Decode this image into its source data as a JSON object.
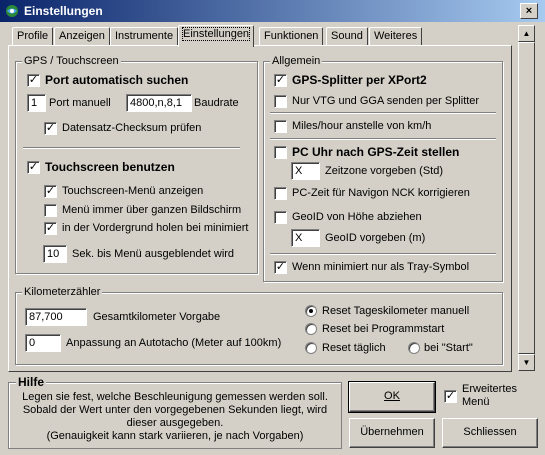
{
  "window": {
    "title": "Einstellungen",
    "close_label": "×"
  },
  "tabs": [
    {
      "label": "Profile"
    },
    {
      "label": "Anzeigen"
    },
    {
      "label": "Instrumente"
    },
    {
      "label": "Einstellungen"
    },
    {
      "label": "Funktionen"
    },
    {
      "label": "Sound"
    },
    {
      "label": "Weiteres"
    }
  ],
  "active_tab": "Einstellungen",
  "gps": {
    "legend": "GPS / Touchscreen",
    "port_auto_label": "Port automatisch suchen",
    "port_auto_checked": true,
    "port_value": "1",
    "port_label": "Port manuell",
    "baud_value": "4800,n,8,1",
    "baud_label": "Baudrate",
    "checksum_label": "Datensatz-Checksum prüfen",
    "checksum_checked": true,
    "touch_label": "Touchscreen benutzen",
    "touch_checked": true,
    "touch_menu_label": "Touchscreen-Menü anzeigen",
    "touch_menu_checked": true,
    "menu_full_label": "Menü immer über ganzen Bildschirm",
    "menu_full_checked": false,
    "foreground_label": "in der Vordergrund holen bei minimiert",
    "foreground_checked": true,
    "hide_seconds_value": "10",
    "hide_seconds_label": "Sek. bis Menü ausgeblendet wird"
  },
  "allgemein": {
    "legend": "Allgemein",
    "splitter_label": "GPS-Splitter per XPort2",
    "splitter_checked": true,
    "vtg_label": "Nur VTG und GGA senden per Splitter",
    "vtg_checked": false,
    "miles_label": "Miles/hour anstelle von km/h",
    "miles_checked": false,
    "pc_clock_label": "PC Uhr nach GPS-Zeit stellen",
    "pc_clock_checked": false,
    "timezone_value": "X",
    "timezone_label": "Zeitzone vorgeben (Std)",
    "navigon_label": "PC-Zeit für Navigon NCK korrigieren",
    "navigon_checked": false,
    "geoid_label": "GeoID von Höhe abziehen",
    "geoid_checked": false,
    "geoid_value": "X",
    "geoid_value_label": "GeoID vorgeben (m)",
    "tray_label": "Wenn minimiert nur als Tray-Symbol",
    "tray_checked": true
  },
  "km": {
    "legend": "Kilometerzähler",
    "total_value": "87,700",
    "total_label": "Gesamtkilometer Vorgabe",
    "adjust_value": "0",
    "adjust_label": "Anpassung an Autotacho (Meter auf 100km)",
    "reset_manual_label": "Reset Tageskilometer manuell",
    "reset_start_label": "Reset bei Programmstart",
    "reset_daily_label": "Reset täglich",
    "reset_start_btn_label": "bei \"Start\"",
    "selected_reset": "manual"
  },
  "help": {
    "title": "Hilfe",
    "lines": [
      "Legen sie fest, welche Beschleunigung gemessen werden soll.",
      "Sobald der Wert unter den vorgegebenen Sekunden liegt, wird",
      "dieser ausgegeben.",
      "(Genauigkeit kann stark variieren, je nach Vorgaben)"
    ]
  },
  "buttons": {
    "ok_label": "OK",
    "apply_label": "Übernehmen",
    "close_label": "Schliessen"
  },
  "extended": {
    "label_line1": "Erweitertes",
    "label_line2": "Menü",
    "checked": true
  },
  "icons": {
    "check_glyph": "✓",
    "scroll_up": "▲",
    "scroll_down": "▼"
  }
}
